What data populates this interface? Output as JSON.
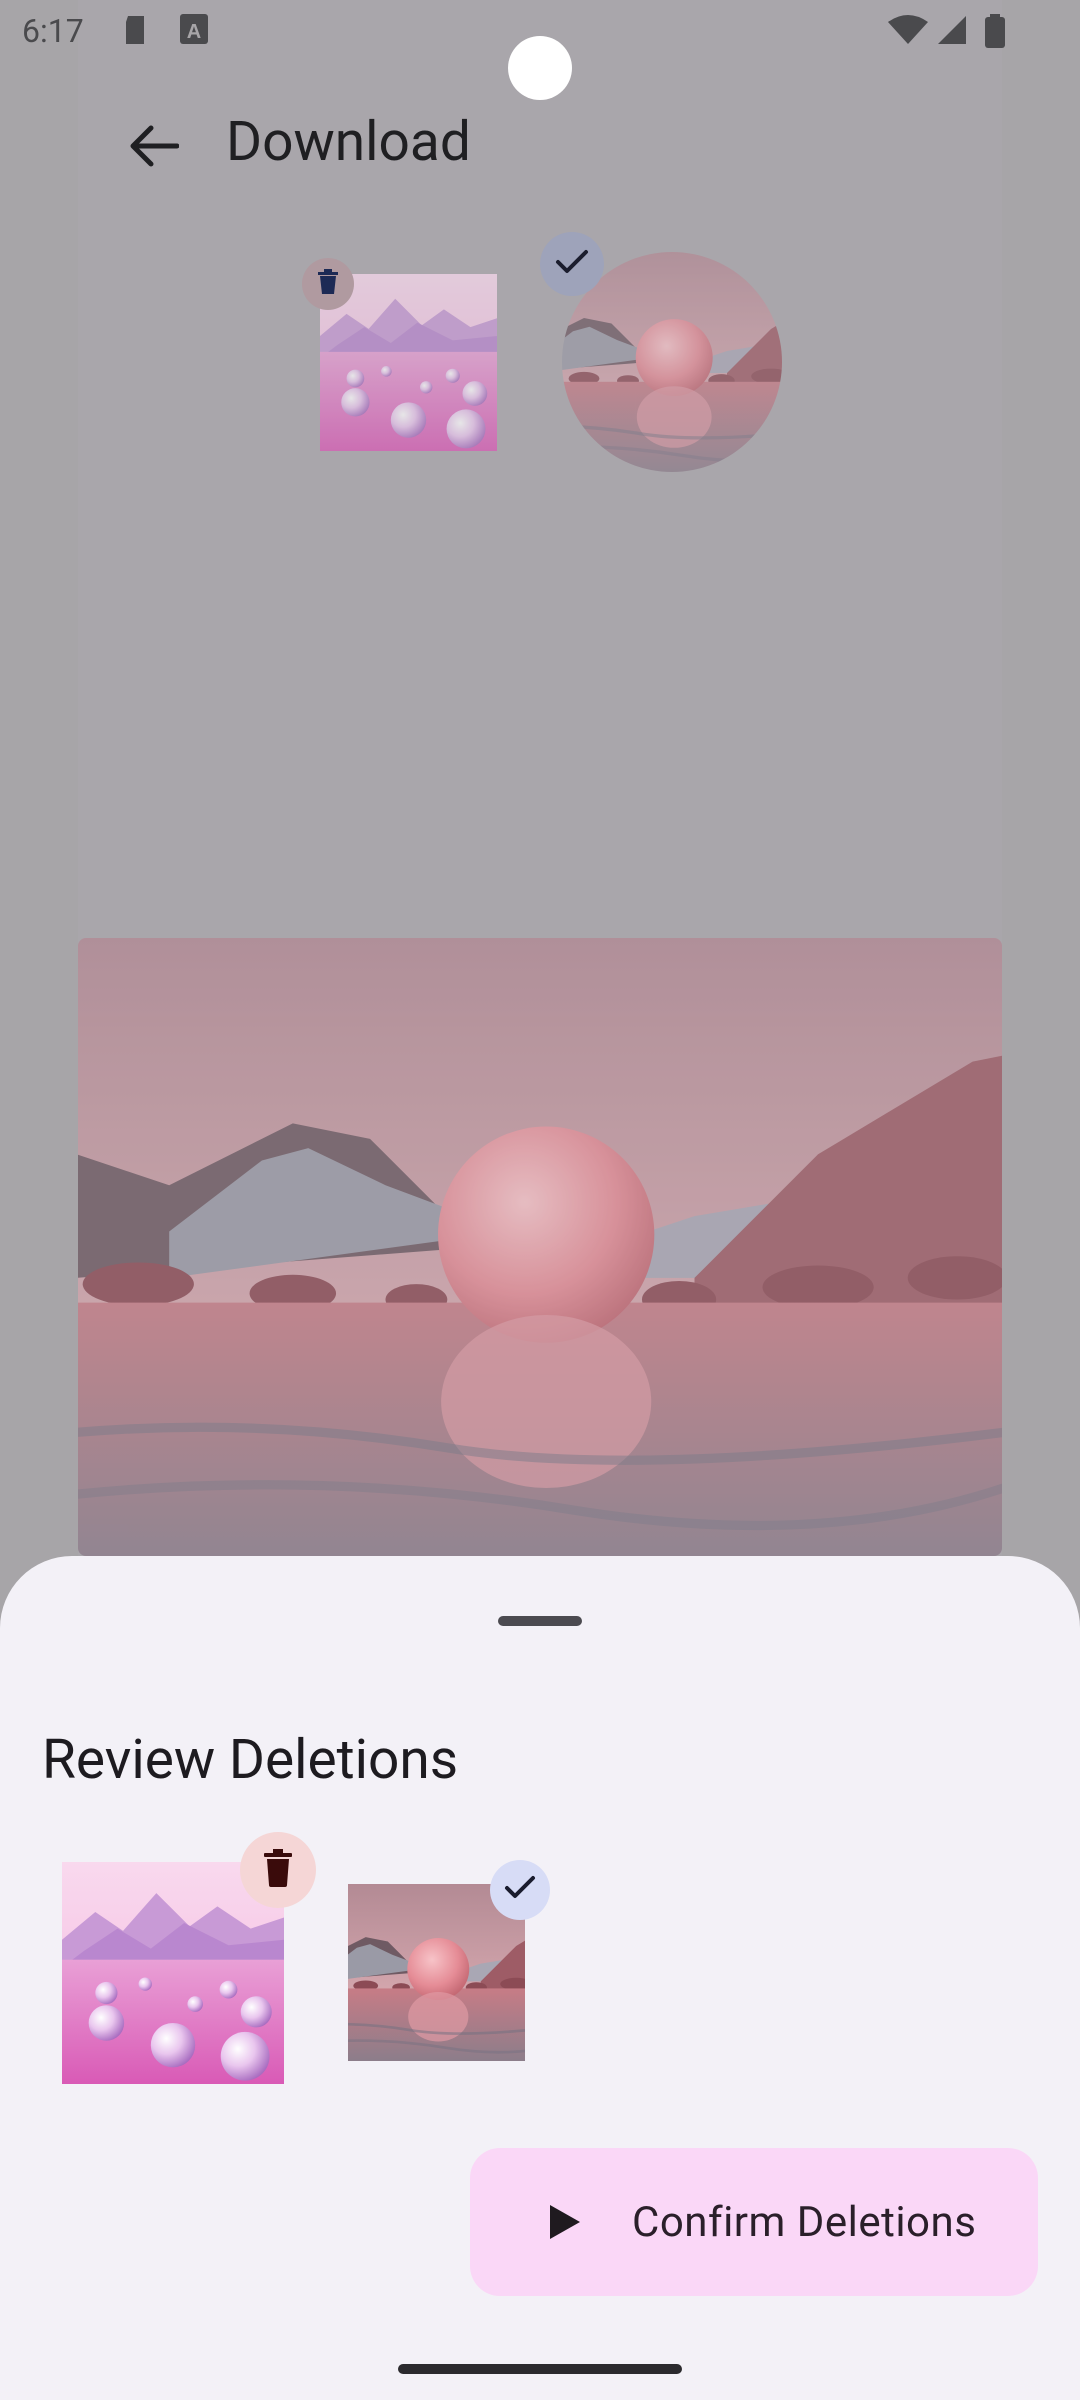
{
  "status_bar": {
    "time": "6:17",
    "icons": [
      "sd-card-icon",
      "text-a-icon",
      "wifi-icon",
      "signal-icon",
      "battery-icon"
    ]
  },
  "app_bar": {
    "title": "Download",
    "back_icon": "arrow-left-icon"
  },
  "grid": {
    "items": [
      {
        "name": "pink-spheres-image",
        "state": "marked-for-deletion",
        "badge_icon": "trash-icon"
      },
      {
        "name": "pink-orb-lake-image",
        "state": "kept",
        "badge_icon": "check-icon"
      }
    ]
  },
  "bottom_sheet": {
    "title": "Review Deletions",
    "items": [
      {
        "name": "pink-spheres-image",
        "badge_icon": "trash-icon"
      },
      {
        "name": "pink-orb-lake-image",
        "badge_icon": "check-icon"
      }
    ],
    "confirm_button": {
      "label": "Confirm Deletions",
      "icon": "play-icon"
    }
  },
  "colors": {
    "scrim": "#a7a5a8",
    "sheet_bg": "#f3f1f7",
    "confirm_bg": "#fad7f7",
    "trash_badge": "#f5d6d6",
    "check_badge": "#d7dcf6"
  }
}
